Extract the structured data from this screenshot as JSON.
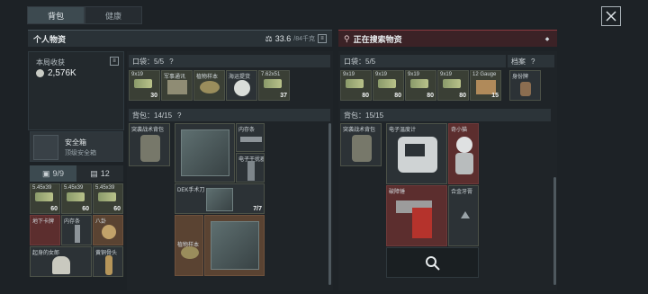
{
  "tabs": [
    {
      "label": "背包"
    },
    {
      "label": "健康"
    }
  ],
  "left": {
    "title": "个人物资",
    "weight": "33.6",
    "weight_max": "/84千克",
    "income_label": "本局收获",
    "income_value": "2,576K",
    "safebox_name": "安全箱",
    "safebox_sub": "顶级安全箱",
    "filter_a": "9/9",
    "filter_b": "12",
    "pocket_label": "口袋：5/5",
    "pocket_help": "?",
    "pocket_items": [
      {
        "label": "9x19",
        "count": "30"
      },
      {
        "label": "军事通讯",
        "count": ""
      },
      {
        "label": "植物样本",
        "count": ""
      },
      {
        "label": "海运提货",
        "count": ""
      },
      {
        "label": "7.62x51",
        "count": "37"
      }
    ],
    "backpack_label": "背包：14/15",
    "backpack_help": "?",
    "backpack_items": {
      "tactical": "突袭战术背包",
      "crate_a": "",
      "cable": "内存条",
      "adapter": "电子干扰器",
      "knife": "DEK手术刀",
      "count_77": "7/7",
      "sample": "植物样本"
    },
    "safe_items": [
      {
        "label": "5.45x39",
        "count": "60"
      },
      {
        "label": "5.45x39",
        "count": "60"
      },
      {
        "label": "5.45x39",
        "count": "60"
      },
      {
        "label": "地下卡牌",
        "count": ""
      },
      {
        "label": "内存条",
        "count": ""
      },
      {
        "label": "八卦",
        "count": ""
      },
      {
        "label": "起身的女郎",
        "count": ""
      },
      {
        "label": "黄铜骨头",
        "count": ""
      }
    ]
  },
  "right": {
    "title": "正在搜索物资",
    "pocket_label": "口袋：5/5",
    "archive_label": "档案",
    "archive_help": "?",
    "pocket_items": [
      {
        "label": "9x19",
        "count": "80"
      },
      {
        "label": "9x19",
        "count": "80"
      },
      {
        "label": "9x19",
        "count": "80"
      },
      {
        "label": "9x19",
        "count": "80"
      },
      {
        "label": "12 Gauge",
        "count": "15"
      }
    ],
    "archive_item": "身份牌",
    "backpack_label": "背包：15/15",
    "backpack_items": {
      "tactical": "突袭战术背包",
      "thermo": "电子温度计",
      "doll": "奇小猫",
      "drill": "破障锤",
      "metal": "合金牙膏"
    }
  }
}
